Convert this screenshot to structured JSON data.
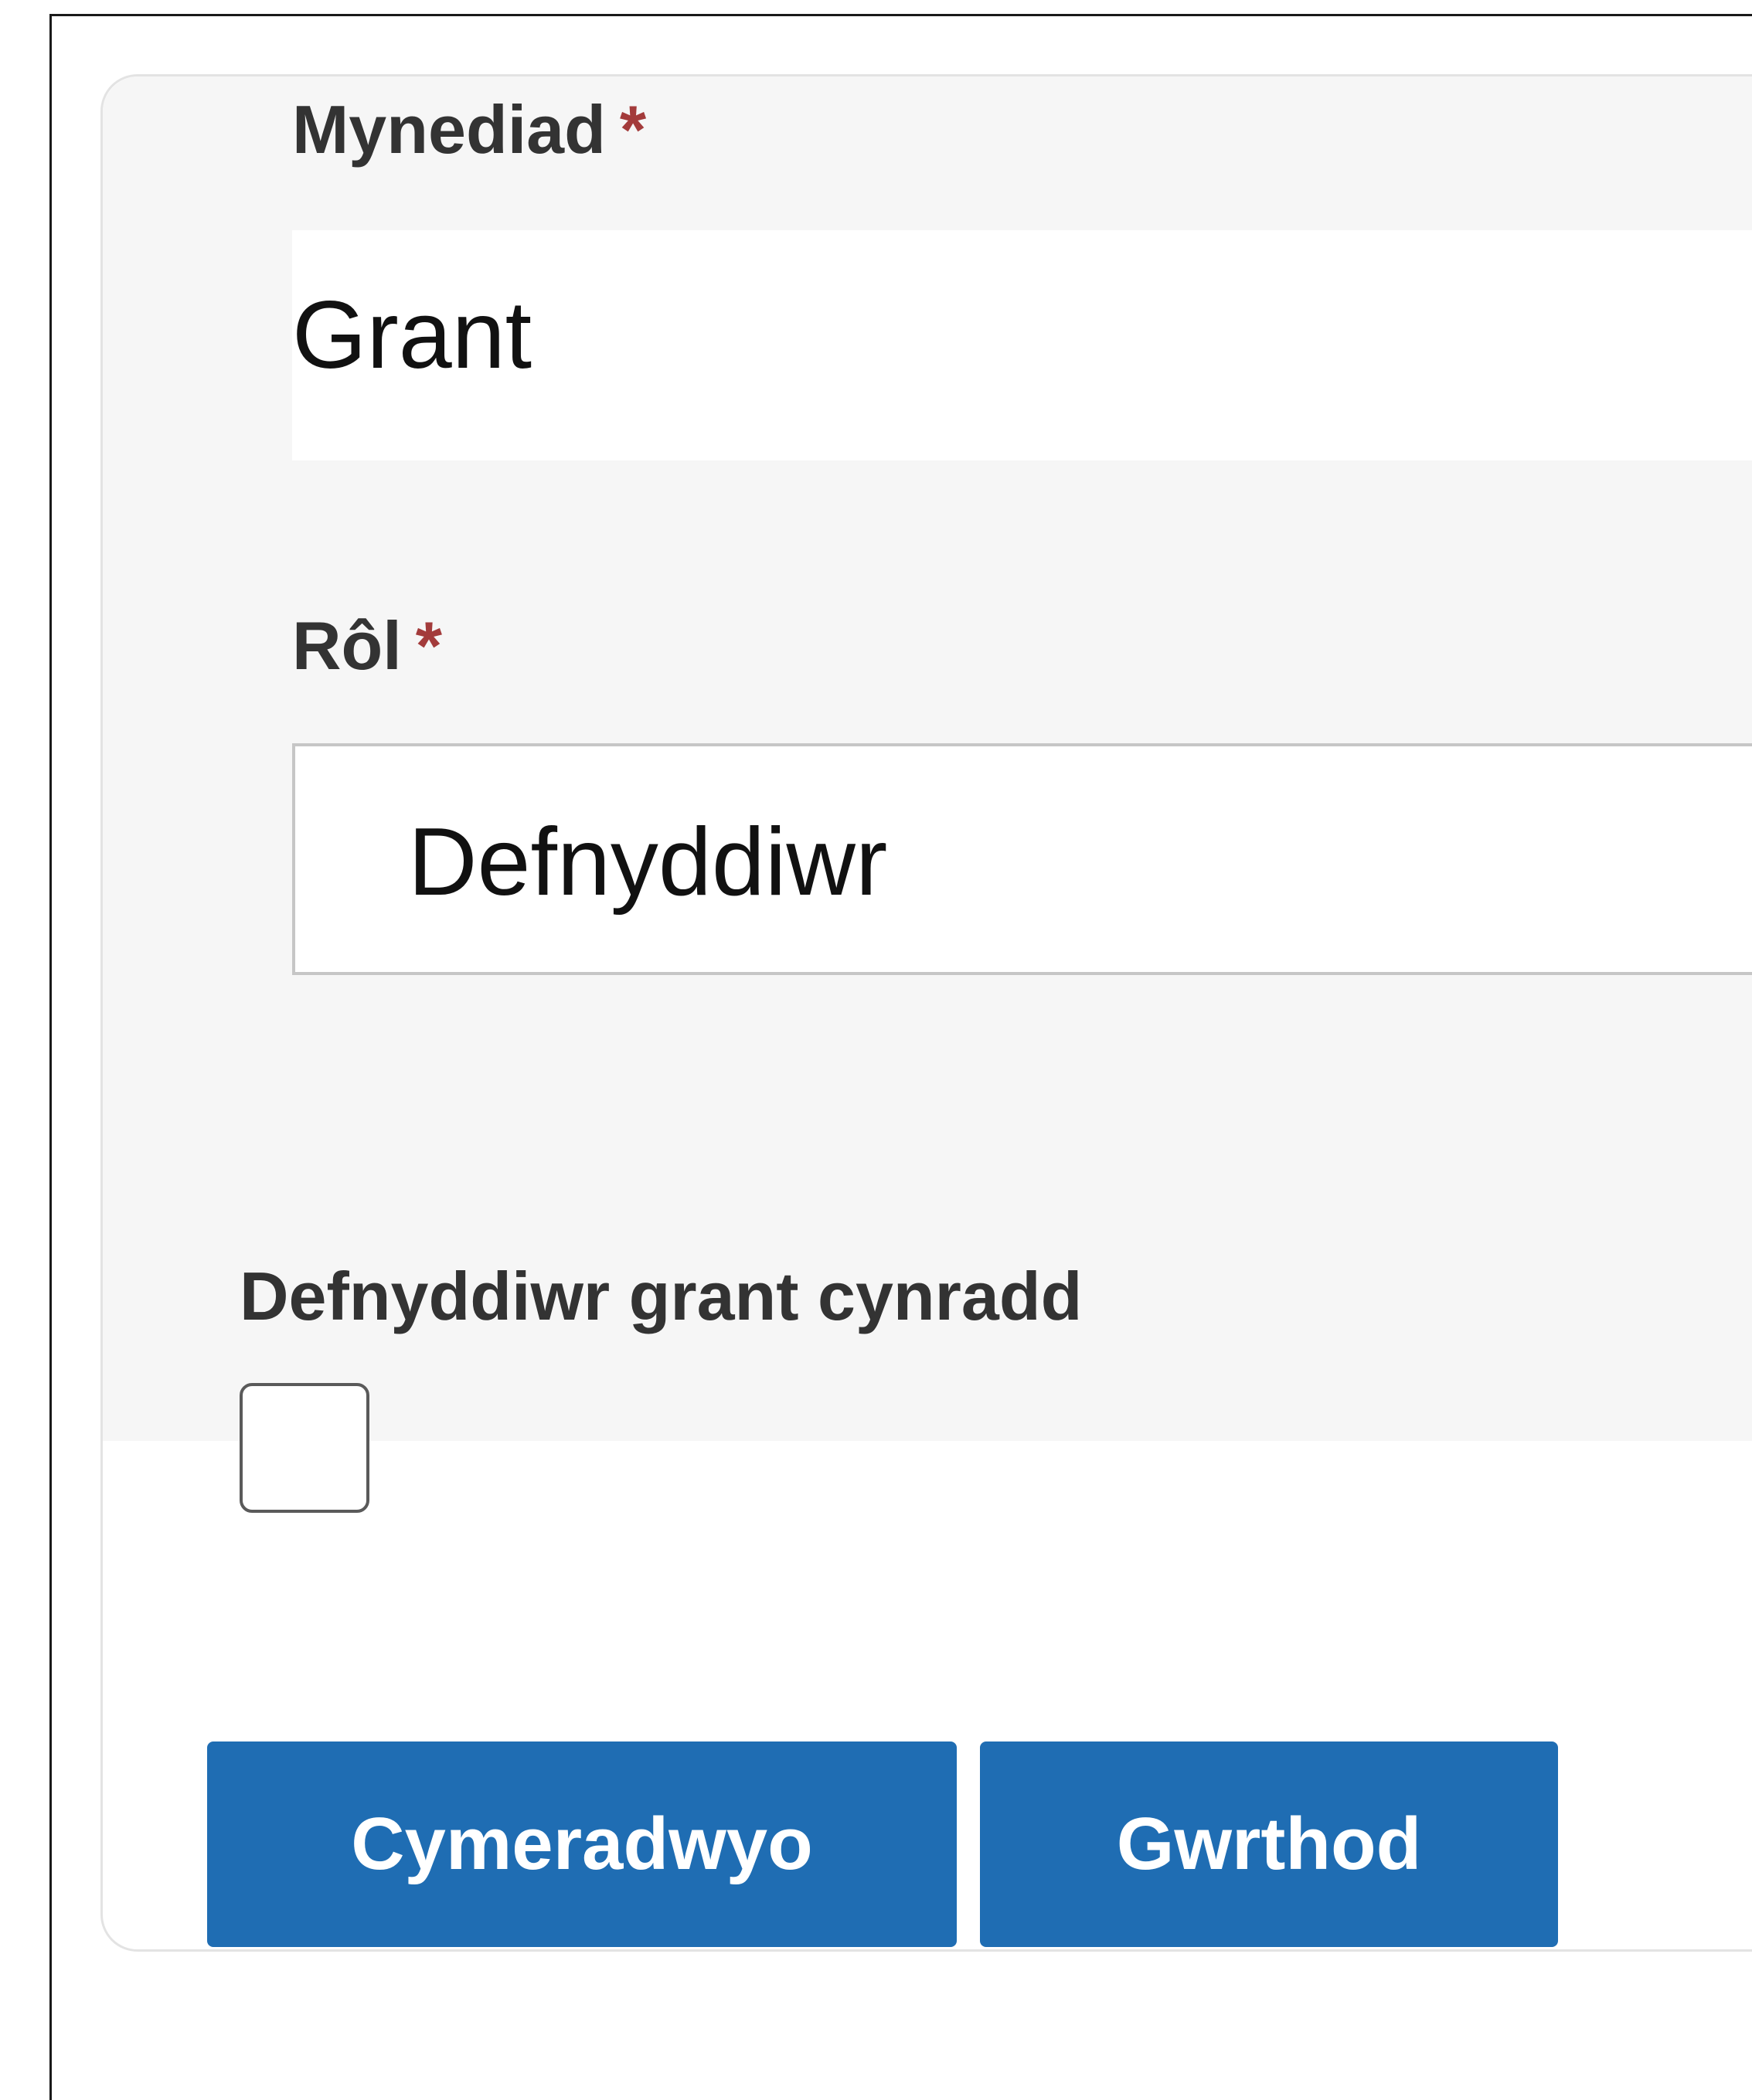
{
  "form": {
    "access": {
      "label": "Mynediad",
      "required_mark": "*",
      "value": "Grant"
    },
    "role": {
      "label": "Rôl",
      "required_mark": "*",
      "value": "Defnyddiwr"
    },
    "primary_grant_user": {
      "label": "Defnyddiwr grant cynradd",
      "checked": false
    }
  },
  "actions": {
    "approve_label": "Cymeradwyo",
    "reject_label": "Gwrthod"
  },
  "colors": {
    "button_bg": "#1f6db3",
    "required_mark": "#a33b3b",
    "panel_bg": "#f6f6f6"
  }
}
